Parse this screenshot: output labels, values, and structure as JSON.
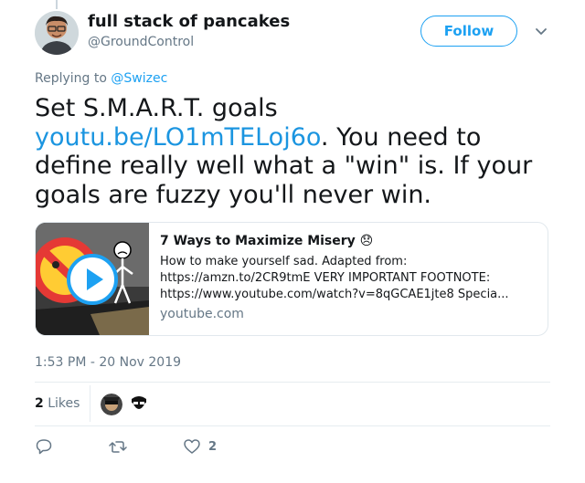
{
  "author": {
    "name": "full stack of pancakes",
    "handle": "@GroundControl",
    "follow_label": "Follow"
  },
  "reply": {
    "prefix": "Replying to ",
    "to": "@Swizec"
  },
  "tweet": {
    "text_before": "Set S.M.A.R.T. goals ",
    "link": "youtu.be/LO1mTELoj6o",
    "text_after": ". You need to define really well what a \"win\" is. If your goals are fuzzy you'll never win."
  },
  "card": {
    "title": "7 Ways to Maximize Misery 😞",
    "description_line1": "How to make yourself sad. Adapted from:",
    "description_line2": "https://amzn.to/2CR9tmE VERY IMPORTANT FOOTNOTE:",
    "description_line3": "https://www.youtube.com/watch?v=8qGCAE1jte8 Specia...",
    "domain": "youtube.com"
  },
  "timestamp": "1:53 PM - 20 Nov 2019",
  "likes": {
    "count": "2",
    "label": "Likes"
  },
  "actions": {
    "like_count": "2"
  },
  "colors": {
    "accent": "#1da1f2",
    "link": "#1b95e0",
    "secondary_text": "#657786",
    "border": "#e1e8ed"
  },
  "icons": [
    "reply-icon",
    "retweet-icon",
    "like-icon",
    "chevron-down-icon",
    "play-icon"
  ]
}
